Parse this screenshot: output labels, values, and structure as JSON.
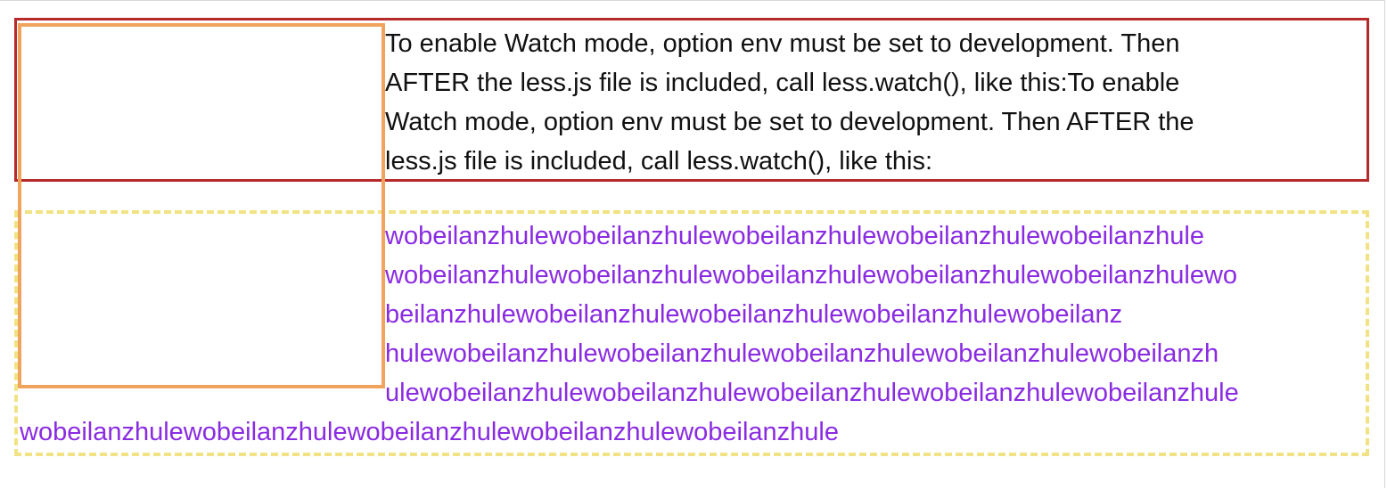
{
  "paragraph": {
    "lines": [
      "To enable Watch mode, option env must be set to development. Then",
      "AFTER the less.js file is included, call less.watch(), like this:To enable",
      "Watch mode, option env must be set to development. Then AFTER the",
      "less.js file is included, call less.watch(), like this:"
    ]
  },
  "wrapped_text": {
    "lines": [
      "wobeilanzhulewobeilanzhulewobeilanzhulewobeilanzhulewobeilanzhule",
      "wobeilanzhulewobeilanzhulewobeilanzhulewobeilanzhulewobeilanzhulewo",
      "beilanzhulewobeilanzhulewobeilanzhulewobeilanzhulewobeilanz",
      "hulewobeilanzhulewobeilanzhulewobeilanzhulewobeilanzhulewobeilanzh",
      "ulewobeilanzhulewobeilanzhulewobeilanzhulewobeilanzhulewobeilanzhule",
      "wobeilanzhulewobeilanzhulewobeilanzhulewobeilanzhulewobeilanzhule"
    ]
  },
  "colors": {
    "red_border": "#b72a2a",
    "yellow_dashed_border": "#f1e384",
    "orange_float_border": "#f0a35c",
    "purple_text": "#8a2be2",
    "body_text": "#111111"
  }
}
